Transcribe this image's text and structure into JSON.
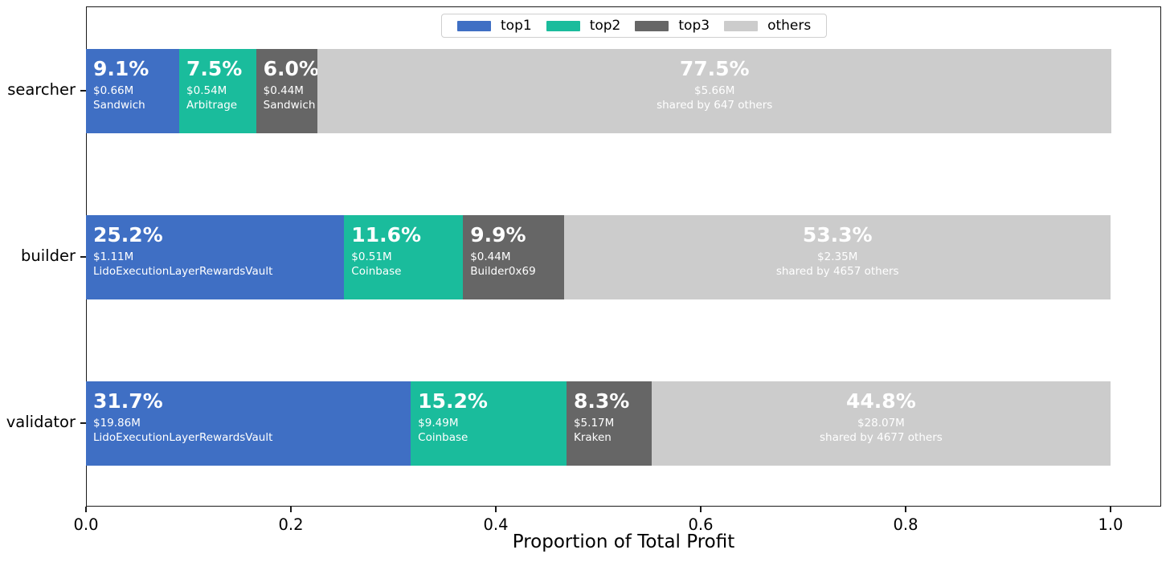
{
  "chart_data": {
    "type": "bar",
    "orientation": "horizontal",
    "stacked": true,
    "normalized": true,
    "title": "",
    "xlabel": "Proportion of Total Profit",
    "ylabel": "",
    "xlim": [
      0.0,
      1.0
    ],
    "xticks": [
      "0.0",
      "0.2",
      "0.4",
      "0.6",
      "0.8",
      "1.0"
    ],
    "xtick_values": [
      0.0,
      0.2,
      0.4,
      0.6,
      0.8,
      1.0
    ],
    "grid": false,
    "legend_position": "upper center",
    "categories": [
      "searcher",
      "builder",
      "validator"
    ],
    "series": [
      {
        "name": "top1",
        "color": "#3f6fc4",
        "values": [
          0.091,
          0.252,
          0.317
        ]
      },
      {
        "name": "top2",
        "color": "#1abc9c",
        "values": [
          0.075,
          0.116,
          0.152
        ]
      },
      {
        "name": "top3",
        "color": "#666666",
        "values": [
          0.06,
          0.099,
          0.083
        ]
      },
      {
        "name": "others",
        "color": "#cccccc",
        "values": [
          0.775,
          0.533,
          0.448
        ]
      }
    ],
    "annotations": [
      {
        "category": "searcher",
        "segments": [
          {
            "series": "top1",
            "pct": "9.1%",
            "amount": "$0.66M",
            "label": "Sandwich"
          },
          {
            "series": "top2",
            "pct": "7.5%",
            "amount": "$0.54M",
            "label": "Arbitrage"
          },
          {
            "series": "top3",
            "pct": "6.0%",
            "amount": "$0.44M",
            "label": "Sandwich"
          },
          {
            "series": "others",
            "pct": "77.5%",
            "amount": "$5.66M",
            "label": "shared by 647 others"
          }
        ]
      },
      {
        "category": "builder",
        "segments": [
          {
            "series": "top1",
            "pct": "25.2%",
            "amount": "$1.11M",
            "label": "LidoExecutionLayerRewardsVault"
          },
          {
            "series": "top2",
            "pct": "11.6%",
            "amount": "$0.51M",
            "label": "Coinbase"
          },
          {
            "series": "top3",
            "pct": "9.9%",
            "amount": "$0.44M",
            "label": "Builder0x69"
          },
          {
            "series": "others",
            "pct": "53.3%",
            "amount": "$2.35M",
            "label": "shared by 4657 others"
          }
        ]
      },
      {
        "category": "validator",
        "segments": [
          {
            "series": "top1",
            "pct": "31.7%",
            "amount": "$19.86M",
            "label": "LidoExecutionLayerRewardsVault"
          },
          {
            "series": "top2",
            "pct": "15.2%",
            "amount": "$9.49M",
            "label": "Coinbase"
          },
          {
            "series": "top3",
            "pct": "8.3%",
            "amount": "$5.17M",
            "label": "Kraken"
          },
          {
            "series": "others",
            "pct": "44.8%",
            "amount": "$28.07M",
            "label": "shared by 4677 others"
          }
        ]
      }
    ]
  },
  "legend": {
    "items": [
      {
        "label": "top1",
        "color": "#3f6fc4"
      },
      {
        "label": "top2",
        "color": "#1abc9c"
      },
      {
        "label": "top3",
        "color": "#666666"
      },
      {
        "label": "others",
        "color": "#cccccc"
      }
    ]
  },
  "axes": {
    "x_title": "Proportion of Total Profit",
    "x_tick_labels": [
      "0.0",
      "0.2",
      "0.4",
      "0.6",
      "0.8",
      "1.0"
    ],
    "y_tick_labels": [
      "searcher",
      "builder",
      "validator"
    ]
  }
}
